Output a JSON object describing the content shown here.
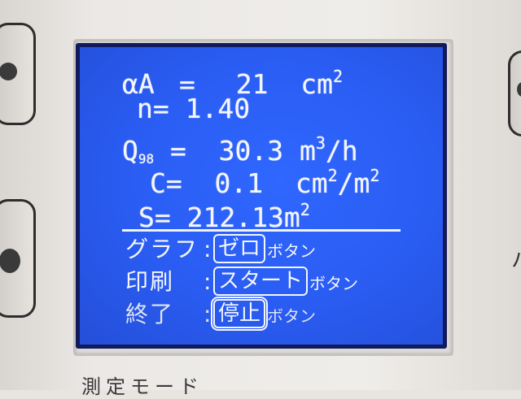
{
  "lcd": {
    "rows": [
      {
        "label": "αA",
        "eq": "=",
        "value": "21",
        "unit_base": "cm",
        "unit_sup": "2",
        "unit_tail": ""
      },
      {
        "label": "n",
        "eq": "=",
        "value": "1.40",
        "unit_base": "",
        "unit_sup": "",
        "unit_tail": ""
      },
      {
        "label": "Q",
        "label_sub": "98",
        "eq": "=",
        "value": "30.3",
        "unit_base": "m",
        "unit_sup": "3",
        "unit_tail": "/h"
      },
      {
        "label": "C",
        "eq": "=",
        "value": "0.1",
        "unit_base": "cm",
        "unit_sup": "2",
        "unit_tail": "/m",
        "unit_sup2": "2"
      },
      {
        "label": "S",
        "eq": "=",
        "value": "212.13",
        "unit_base": "m",
        "unit_sup": "2",
        "unit_tail": ""
      }
    ],
    "menu": [
      {
        "label": "グラフ",
        "key": "ゼロ",
        "suffix": "ボタン"
      },
      {
        "label": "印刷",
        "key": "スタート",
        "suffix": "ボタン"
      },
      {
        "label": "終了",
        "key": "停止",
        "suffix": "ボタン"
      }
    ]
  },
  "housing": {
    "below_text": "測定モード",
    "side_mark": "ハ"
  },
  "colors": {
    "lcd_background": "#2a5cf2",
    "lcd_text": "#f4f6ff",
    "housing": "#ebe8e5"
  }
}
